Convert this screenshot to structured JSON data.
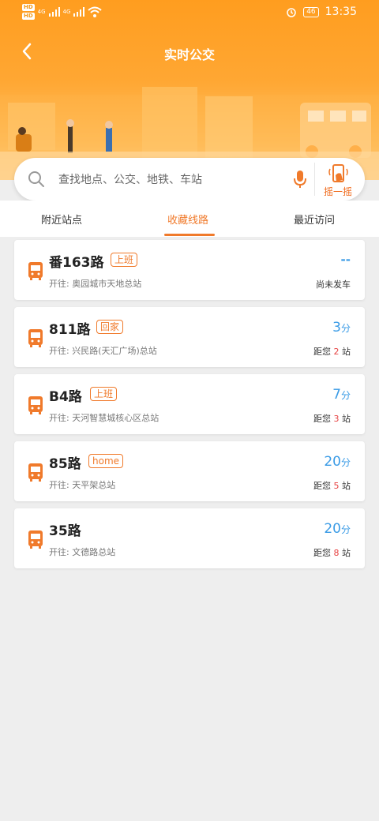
{
  "status_bar": {
    "left_tags": [
      "HD",
      "HD"
    ],
    "network": [
      "4G",
      "4G"
    ],
    "time": "13:35",
    "battery": "46"
  },
  "header": {
    "title": "实时公交",
    "back_icon": "chevron-left-icon"
  },
  "search": {
    "placeholder": "查找地点、公交、地铁、车站",
    "shake_label": "摇一摇"
  },
  "tabs": [
    {
      "label": "附近站点",
      "active": false
    },
    {
      "label": "收藏线路",
      "active": true
    },
    {
      "label": "最近访问",
      "active": false
    }
  ],
  "routes": [
    {
      "name": "番163路",
      "tag": "上班",
      "dest": "开往: 奥园城市天地总站",
      "eta": "--",
      "status": "尚未发车"
    },
    {
      "name": "811路",
      "tag": "回家",
      "dest": "开往: 兴民路(天汇广场)总站",
      "eta_value": "3",
      "eta_unit": "分",
      "dist_prefix": "距您",
      "stops": "2",
      "dist_suffix": "站"
    },
    {
      "name": "B4路",
      "tag": "上班",
      "dest": "开往: 天河智慧城核心区总站",
      "eta_value": "7",
      "eta_unit": "分",
      "dist_prefix": "距您",
      "stops": "3",
      "dist_suffix": "站"
    },
    {
      "name": "85路",
      "tag": "home",
      "dest": "开往: 天平架总站",
      "eta_value": "20",
      "eta_unit": "分",
      "dist_prefix": "距您",
      "stops": "5",
      "dist_suffix": "站"
    },
    {
      "name": "35路",
      "tag": "",
      "dest": "开往: 文德路总站",
      "eta_value": "20",
      "eta_unit": "分",
      "dist_prefix": "距您",
      "stops": "8",
      "dist_suffix": "站"
    }
  ],
  "colors": {
    "accent": "#f07a2b",
    "eta_blue": "#3a9be6",
    "stop_red": "#e64343",
    "header_orange": "#ffa733"
  }
}
